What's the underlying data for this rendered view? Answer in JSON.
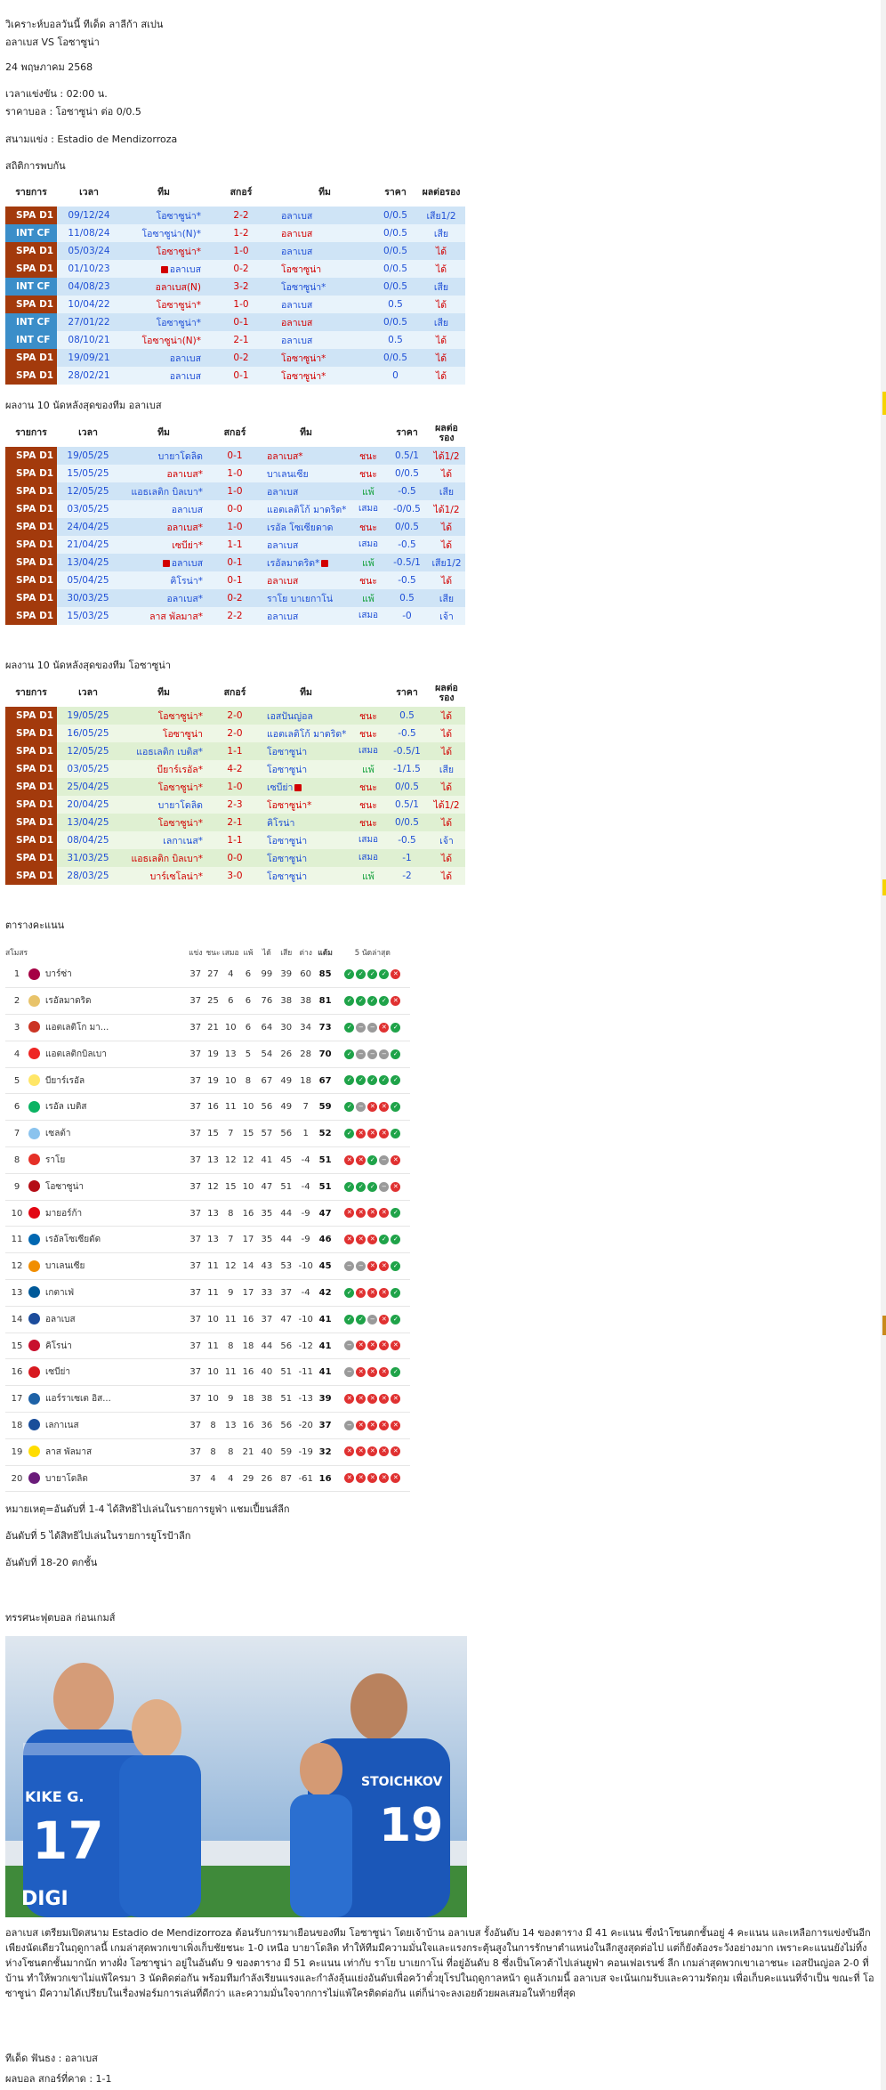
{
  "meta": {
    "title": "วิเคราะห์บอลวันนี้ ทีเด็ด ลาลีก้า สเปน",
    "match": "อลาเบส VS โอซาซูน่า",
    "date": "24 พฤษภาคม 2568",
    "kickoff": "เวลาแข่งขัน : 02:00  น.",
    "odds": "ราคาบอล : โอซาซูน่า ต่อ 0/0.5",
    "stadium": "สนามแข่ง : Estadio de Mendizorroza"
  },
  "h2h": {
    "label": "สถิติการพบกัน",
    "headers": [
      "รายการ",
      "เวลา",
      "ทีม",
      "สกอร์",
      "ทีม",
      "ราคา",
      "ผลต่อรอง"
    ],
    "rows": [
      {
        "league": "SPA D1",
        "kind": "spa",
        "date": "09/12/24",
        "home": "โอซาซูน่า*",
        "hc": "blue",
        "score": "2-2",
        "away": "อลาเบส",
        "ac": "blue",
        "hcp": "0/0.5",
        "res": "เสีย1/2",
        "rc": "b",
        "bg": "#cfe4f6"
      },
      {
        "league": "INT CF",
        "kind": "int",
        "date": "11/08/24",
        "home": "โอซาซูน่า(N)*",
        "hc": "blue",
        "score": "1-2",
        "away": "อลาเบส",
        "ac": "red",
        "hcp": "0/0.5",
        "res": "เสีย",
        "rc": "b",
        "bg": "#e8f3fb"
      },
      {
        "league": "SPA D1",
        "kind": "spa",
        "date": "05/03/24",
        "home": "โอซาซูน่า*",
        "hc": "red",
        "score": "1-0",
        "away": "อลาเบส",
        "ac": "blue",
        "hcp": "0/0.5",
        "res": "ได้",
        "rc": "r",
        "bg": "#cfe4f6"
      },
      {
        "league": "SPA D1",
        "kind": "spa",
        "date": "01/10/23",
        "home": "อลาเบส",
        "hc": "blue",
        "flag": true,
        "score": "0-2",
        "away": "โอซาซูน่า",
        "ac": "red",
        "hcp": "0/0.5",
        "res": "ได้",
        "rc": "r",
        "bg": "#e8f3fb"
      },
      {
        "league": "INT CF",
        "kind": "int",
        "date": "04/08/23",
        "home": "อลาเบส(N)",
        "hc": "red",
        "score": "3-2",
        "away": "โอซาซูน่า*",
        "ac": "blue",
        "hcp": "0/0.5",
        "res": "เสีย",
        "rc": "b",
        "bg": "#cfe4f6"
      },
      {
        "league": "SPA D1",
        "kind": "spa",
        "date": "10/04/22",
        "home": "โอซาซูน่า*",
        "hc": "red",
        "score": "1-0",
        "away": "อลาเบส",
        "ac": "blue",
        "hcp": "0.5",
        "res": "ได้",
        "rc": "r",
        "bg": "#e8f3fb"
      },
      {
        "league": "INT CF",
        "kind": "int",
        "date": "27/01/22",
        "home": "โอซาซูน่า*",
        "hc": "blue",
        "score": "0-1",
        "away": "อลาเบส",
        "ac": "red",
        "hcp": "0/0.5",
        "res": "เสีย",
        "rc": "b",
        "bg": "#cfe4f6"
      },
      {
        "league": "INT CF",
        "kind": "int",
        "date": "08/10/21",
        "home": "โอซาซูน่า(N)*",
        "hc": "red",
        "score": "2-1",
        "away": "อลาเบส",
        "ac": "blue",
        "hcp": "0.5",
        "res": "ได้",
        "rc": "r",
        "bg": "#e8f3fb"
      },
      {
        "league": "SPA D1",
        "kind": "spa",
        "date": "19/09/21",
        "home": "อลาเบส",
        "hc": "blue",
        "score": "0-2",
        "away": "โอซาซูน่า*",
        "ac": "red",
        "hcp": "0/0.5",
        "res": "ได้",
        "rc": "r",
        "bg": "#cfe4f6"
      },
      {
        "league": "SPA D1",
        "kind": "spa",
        "date": "28/02/21",
        "home": "อลาเบส",
        "hc": "blue",
        "score": "0-1",
        "away": "โอซาซูน่า*",
        "ac": "red",
        "hcp": "0",
        "res": "ได้",
        "rc": "r",
        "bg": "#e8f3fb"
      }
    ]
  },
  "formA": {
    "label": "ผลงาน 10 นัดหลังสุดของทีม อลาเบส",
    "headers": [
      "รายการ",
      "เวลา",
      "ทีม",
      "สกอร์",
      "ทีม",
      "",
      "ราคา",
      "ผลต่อรอง"
    ],
    "rows": [
      {
        "league": "SPA D1",
        "date": "19/05/25",
        "home": "บายาโดลิด",
        "hc": "blue",
        "score": "0-1",
        "away": "อลาเบส*",
        "ac": "red",
        "wdl": "ชนะ",
        "wc": "r",
        "hcp": "0.5/1",
        "res": "ได้1/2",
        "rc": "r",
        "bg": "#cfe4f6"
      },
      {
        "league": "SPA D1",
        "date": "15/05/25",
        "home": "อลาเบส*",
        "hc": "red",
        "score": "1-0",
        "away": "บาเลนเซีย",
        "ac": "blue",
        "wdl": "ชนะ",
        "wc": "r",
        "hcp": "0/0.5",
        "res": "ได้",
        "rc": "r",
        "bg": "#e8f3fb"
      },
      {
        "league": "SPA D1",
        "date": "12/05/25",
        "home": "แอธเลติก บิลเบา*",
        "hc": "blue",
        "score": "1-0",
        "away": "อลาเบส",
        "ac": "blue",
        "wdl": "แพ้",
        "wc": "g",
        "hcp": "-0.5",
        "res": "เสีย",
        "rc": "b",
        "bg": "#cfe4f6"
      },
      {
        "league": "SPA D1",
        "date": "03/05/25",
        "home": "อลาเบส",
        "hc": "blue",
        "score": "0-0",
        "away": "แอตเลติโก้ มาดริด*",
        "ac": "blue",
        "wdl": "เสมอ",
        "wc": "b",
        "hcp": "-0/0.5",
        "res": "ได้1/2",
        "rc": "r",
        "bg": "#e8f3fb"
      },
      {
        "league": "SPA D1",
        "date": "24/04/25",
        "home": "อลาเบส*",
        "hc": "red",
        "score": "1-0",
        "away": "เรอัล โซเซียดาด",
        "ac": "blue",
        "wdl": "ชนะ",
        "wc": "r",
        "hcp": "0/0.5",
        "res": "ได้",
        "rc": "r",
        "bg": "#cfe4f6"
      },
      {
        "league": "SPA D1",
        "date": "21/04/25",
        "home": "เซบีย่า*",
        "hc": "red",
        "score": "1-1",
        "away": "อลาเบส",
        "ac": "blue",
        "wdl": "เสมอ",
        "wc": "b",
        "hcp": "-0.5",
        "res": "ได้",
        "rc": "r",
        "bg": "#e8f3fb"
      },
      {
        "league": "SPA D1",
        "date": "13/04/25",
        "home": "อลาเบส",
        "hc": "blue",
        "flag": true,
        "score": "0-1",
        "away": "เรอัลมาดริด*",
        "ac": "blue",
        "aflag": true,
        "wdl": "แพ้",
        "wc": "g",
        "hcp": "-0.5/1",
        "res": "เสีย1/2",
        "rc": "b",
        "bg": "#cfe4f6"
      },
      {
        "league": "SPA D1",
        "date": "05/04/25",
        "home": "คิโรน่า*",
        "hc": "blue",
        "score": "0-1",
        "away": "อลาเบส",
        "ac": "red",
        "wdl": "ชนะ",
        "wc": "r",
        "hcp": "-0.5",
        "res": "ได้",
        "rc": "r",
        "bg": "#e8f3fb"
      },
      {
        "league": "SPA D1",
        "date": "30/03/25",
        "home": "อลาเบส*",
        "hc": "blue",
        "score": "0-2",
        "away": "ราโย บาเยกาโน่",
        "ac": "blue",
        "wdl": "แพ้",
        "wc": "g",
        "hcp": "0.5",
        "res": "เสีย",
        "rc": "b",
        "bg": "#cfe4f6"
      },
      {
        "league": "SPA D1",
        "date": "15/03/25",
        "home": "ลาส พัลมาส*",
        "hc": "red",
        "score": "2-2",
        "away": "อลาเบส",
        "ac": "blue",
        "wdl": "เสมอ",
        "wc": "b",
        "hcp": "-0",
        "res": "เจ้า",
        "rc": "b",
        "bg": "#e8f3fb"
      }
    ]
  },
  "formB": {
    "label": "ผลงาน 10 นัดหลังสุดของทีม โอซาซูน่า",
    "headers": [
      "รายการ",
      "เวลา",
      "ทีม",
      "สกอร์",
      "ทีม",
      "",
      "ราคา",
      "ผลต่อรอง"
    ],
    "rows": [
      {
        "league": "SPA D1",
        "date": "19/05/25",
        "home": "โอซาซูน่า*",
        "hc": "red",
        "score": "2-0",
        "away": "เอสปันญ่อล",
        "ac": "blue",
        "wdl": "ชนะ",
        "wc": "r",
        "hcp": "0.5",
        "res": "ได้",
        "rc": "r",
        "bg": "#dff0d2"
      },
      {
        "league": "SPA D1",
        "date": "16/05/25",
        "home": "โอซาซูน่า",
        "hc": "red",
        "score": "2-0",
        "away": "แอตเลติโก้ มาดริด*",
        "ac": "blue",
        "wdl": "ชนะ",
        "wc": "r",
        "hcp": "-0.5",
        "res": "ได้",
        "rc": "r",
        "bg": "#eef7e6"
      },
      {
        "league": "SPA D1",
        "date": "12/05/25",
        "home": "แอธเลติก เบติส*",
        "hc": "blue",
        "score": "1-1",
        "away": "โอซาซูน่า",
        "ac": "blue",
        "wdl": "เสมอ",
        "wc": "b",
        "hcp": "-0.5/1",
        "res": "ได้",
        "rc": "r",
        "bg": "#dff0d2"
      },
      {
        "league": "SPA D1",
        "date": "03/05/25",
        "home": "บียาร์เรอัล*",
        "hc": "red",
        "score": "4-2",
        "away": "โอซาซูน่า",
        "ac": "blue",
        "wdl": "แพ้",
        "wc": "g",
        "hcp": "-1/1.5",
        "res": "เสีย",
        "rc": "b",
        "bg": "#eef7e6"
      },
      {
        "league": "SPA D1",
        "date": "25/04/25",
        "home": "โอซาซูน่า*",
        "hc": "red",
        "score": "1-0",
        "away": "เซบีย่า",
        "ac": "blue",
        "aflag": true,
        "wdl": "ชนะ",
        "wc": "r",
        "hcp": "0/0.5",
        "res": "ได้",
        "rc": "r",
        "bg": "#dff0d2"
      },
      {
        "league": "SPA D1",
        "date": "20/04/25",
        "home": "บายาโดลิด",
        "hc": "blue",
        "score": "2-3",
        "away": "โอซาซูน่า*",
        "ac": "red",
        "wdl": "ชนะ",
        "wc": "r",
        "hcp": "0.5/1",
        "res": "ได้1/2",
        "rc": "r",
        "bg": "#eef7e6"
      },
      {
        "league": "SPA D1",
        "date": "13/04/25",
        "home": "โอซาซูน่า*",
        "hc": "red",
        "score": "2-1",
        "away": "คิโรน่า",
        "ac": "blue",
        "wdl": "ชนะ",
        "wc": "r",
        "hcp": "0/0.5",
        "res": "ได้",
        "rc": "r",
        "bg": "#dff0d2"
      },
      {
        "league": "SPA D1",
        "date": "08/04/25",
        "home": "เลกาเนส*",
        "hc": "blue",
        "score": "1-1",
        "away": "โอซาซูน่า",
        "ac": "blue",
        "wdl": "เสมอ",
        "wc": "b",
        "hcp": "-0.5",
        "res": "เจ้า",
        "rc": "b",
        "bg": "#eef7e6"
      },
      {
        "league": "SPA D1",
        "date": "31/03/25",
        "home": "แอธเลติก บิลเบา*",
        "hc": "red",
        "score": "0-0",
        "away": "โอซาซูน่า",
        "ac": "blue",
        "wdl": "เสมอ",
        "wc": "b",
        "hcp": "-1",
        "res": "ได้",
        "rc": "r",
        "bg": "#dff0d2"
      },
      {
        "league": "SPA D1",
        "date": "28/03/25",
        "home": "บาร์เซโลน่า*",
        "hc": "red",
        "score": "3-0",
        "away": "โอซาซูน่า",
        "ac": "blue",
        "wdl": "แพ้",
        "wc": "g",
        "hcp": "-2",
        "res": "ได้",
        "rc": "r",
        "bg": "#eef7e6"
      }
    ]
  },
  "standings": {
    "label": "ตารางคะแนน",
    "headers": [
      "สโมสร",
      "แข่ง",
      "ชนะ",
      "เสมอ",
      "แพ้",
      "ได้",
      "เสีย",
      "ต่าง",
      "แต้ม",
      "5 นัดล่าสุด"
    ],
    "rows": [
      {
        "pos": "1",
        "team": "บาร์ซ่า",
        "c": "#a50044",
        "p": "37",
        "w": "27",
        "d": "4",
        "l": "6",
        "gf": "99",
        "ga": "39",
        "gd": "60",
        "pts": "85",
        "form": "wwwwl"
      },
      {
        "pos": "2",
        "team": "เรอัลมาดริด",
        "c": "#e8c36a",
        "p": "37",
        "w": "25",
        "d": "6",
        "l": "6",
        "gf": "76",
        "ga": "38",
        "gd": "38",
        "pts": "81",
        "form": "wwwwl"
      },
      {
        "pos": "3",
        "team": "แอตเลติโก มา...",
        "c": "#cb3524",
        "p": "37",
        "w": "21",
        "d": "10",
        "l": "6",
        "gf": "64",
        "ga": "30",
        "gd": "34",
        "pts": "73",
        "form": "wddlw"
      },
      {
        "pos": "4",
        "team": "แอตเลติกบิลเบา",
        "c": "#ee2523",
        "p": "37",
        "w": "19",
        "d": "13",
        "l": "5",
        "gf": "54",
        "ga": "26",
        "gd": "28",
        "pts": "70",
        "form": "wdddw"
      },
      {
        "pos": "5",
        "team": "บียาร์เรอัล",
        "c": "#ffe667",
        "p": "37",
        "w": "19",
        "d": "10",
        "l": "8",
        "gf": "67",
        "ga": "49",
        "gd": "18",
        "pts": "67",
        "form": "wwwww"
      },
      {
        "pos": "6",
        "team": "เรอัล เบติส",
        "c": "#0bb363",
        "p": "37",
        "w": "16",
        "d": "11",
        "l": "10",
        "gf": "56",
        "ga": "49",
        "gd": "7",
        "pts": "59",
        "form": "wdllw"
      },
      {
        "pos": "7",
        "team": "เซลต้า",
        "c": "#8ac3ee",
        "p": "37",
        "w": "15",
        "d": "7",
        "l": "15",
        "gf": "57",
        "ga": "56",
        "gd": "1",
        "pts": "52",
        "form": "wlllw"
      },
      {
        "pos": "8",
        "team": "ราโย",
        "c": "#e53027",
        "p": "37",
        "w": "13",
        "d": "12",
        "l": "12",
        "gf": "41",
        "ga": "45",
        "gd": "-4",
        "pts": "51",
        "form": "llwdl"
      },
      {
        "pos": "9",
        "team": "โอซาซูน่า",
        "c": "#b40d16",
        "p": "37",
        "w": "12",
        "d": "15",
        "l": "10",
        "gf": "47",
        "ga": "51",
        "gd": "-4",
        "pts": "51",
        "form": "wwwdl"
      },
      {
        "pos": "10",
        "team": "มายอร์ก้า",
        "c": "#e20613",
        "p": "37",
        "w": "13",
        "d": "8",
        "l": "16",
        "gf": "35",
        "ga": "44",
        "gd": "-9",
        "pts": "47",
        "form": "llllw"
      },
      {
        "pos": "11",
        "team": "เรอัลโซเซียดัด",
        "c": "#0067b1",
        "p": "37",
        "w": "13",
        "d": "7",
        "l": "17",
        "gf": "35",
        "ga": "44",
        "gd": "-9",
        "pts": "46",
        "form": "lllww"
      },
      {
        "pos": "12",
        "team": "บาเลนเซีย",
        "c": "#f18e00",
        "p": "37",
        "w": "11",
        "d": "12",
        "l": "14",
        "gf": "43",
        "ga": "53",
        "gd": "-10",
        "pts": "45",
        "form": "ddllw"
      },
      {
        "pos": "13",
        "team": "เกตาเฟ่",
        "c": "#005999",
        "p": "37",
        "w": "11",
        "d": "9",
        "l": "17",
        "gf": "33",
        "ga": "37",
        "gd": "-4",
        "pts": "42",
        "form": "wlllw"
      },
      {
        "pos": "14",
        "team": "อลาเบส",
        "c": "#1c4c9c",
        "p": "37",
        "w": "10",
        "d": "11",
        "l": "16",
        "gf": "37",
        "ga": "47",
        "gd": "-10",
        "pts": "41",
        "form": "wwdlw"
      },
      {
        "pos": "15",
        "team": "คิโรน่า",
        "c": "#c8102e",
        "p": "37",
        "w": "11",
        "d": "8",
        "l": "18",
        "gf": "44",
        "ga": "56",
        "gd": "-12",
        "pts": "41",
        "form": "dllll"
      },
      {
        "pos": "16",
        "team": "เซบีย่า",
        "c": "#d71920",
        "p": "37",
        "w": "10",
        "d": "11",
        "l": "16",
        "gf": "40",
        "ga": "51",
        "gd": "-11",
        "pts": "41",
        "form": "dlllw"
      },
      {
        "pos": "17",
        "team": "แอร์ราเซเต อิส...",
        "c": "#1e62a7",
        "p": "37",
        "w": "10",
        "d": "9",
        "l": "18",
        "gf": "38",
        "ga": "51",
        "gd": "-13",
        "pts": "39",
        "form": "lllll"
      },
      {
        "pos": "18",
        "team": "เลกาเนส",
        "c": "#1a4e9a",
        "p": "37",
        "w": "8",
        "d": "13",
        "l": "16",
        "gf": "36",
        "ga": "56",
        "gd": "-20",
        "pts": "37",
        "form": "dllll"
      },
      {
        "pos": "19",
        "team": "ลาส พัลมาส",
        "c": "#ffdd00",
        "p": "37",
        "w": "8",
        "d": "8",
        "l": "21",
        "gf": "40",
        "ga": "59",
        "gd": "-19",
        "pts": "32",
        "form": "lllll"
      },
      {
        "pos": "20",
        "team": "บายาโดลิด",
        "c": "#6a1b7a",
        "p": "37",
        "w": "4",
        "d": "4",
        "l": "29",
        "gf": "26",
        "ga": "87",
        "gd": "-61",
        "pts": "16",
        "form": "lllll"
      }
    ]
  },
  "notes": {
    "n1": "หมายเหตุ=อันดับที่ 1-4 ได้สิทธิไปเล่นในรายการยูฟ่า แชมเปี้ยนส์ลีก",
    "n2": "อันดับที่ 5 ได้สิทธิไปเล่นในรายการยูโรป้าลีก",
    "n3": "อันดับที่ 18-20 ตกชั้น"
  },
  "analysis": {
    "label": "ทรรศนะฟุตบอล ก่อนเกมส์",
    "photo_text": [
      "KIKE G.",
      "17",
      "DIGI",
      "STOICHKOV",
      "19"
    ],
    "paragraph": "อลาเบส เตรียมเปิดสนาม Estadio de Mendizorroza ต้อนรับการมาเยือนของทีม โอซาซูน่า โดยเจ้าบ้าน อลาเบส รั้งอันดับ 14 ของตาราง มี 41 คะแนน ซึ่งนำโซนตกชั้นอยู่ 4 คะแนน และเหลือการแข่งขันอีกเพียงนัดเดียวในฤดูกาลนี้ เกมล่าสุดพวกเขาเพิ่งเก็บชัยชนะ 1-0 เหนือ บายาโดลิด ทำให้ทีมมีความมั่นใจและแรงกระตุ้นสูงในการรักษาตำแหน่งในลีกสูงสุดต่อไป แต่ก็ยังต้องระวังอย่างมาก เพราะคะแนนยังไม่ทิ้งห่างโซนตกชั้นมากนัก ทางฝั่ง โอซาซูน่า อยู่ในอันดับ 9 ของตาราง มี 51 คะแนน เท่ากับ ราโย บาเยกาโน่ ที่อยู่อันดับ 8 ซึ่งเป็นโควต้าไปเล่นยูฟ่า คอนเฟอเรนซ์ ลีก เกมล่าสุดพวกเขาเอาชนะ เอสปันญ่อล 2-0 ที่บ้าน ทำให้พวกเขาไม่แพ้ใครมา 3 นัดติดต่อกัน พร้อมทีมกำลังเรียนแรงและกำลังลุ้นแย่งอันดับเพื่อคว้าตั๋วยุโรปในฤดูกาลหน้า ดูแล้วเกมนี้ อลาเบส จะเน้นเกมรับและความรัดกุม เพื่อเก็บคะแนนที่จำเป็น ขณะที่ โอซาซูน่า มีความได้เปรียบในเรื่องฟอร์มการเล่นที่ดีกว่า และความมั่นใจจากการไม่แพ้ใครติดต่อกัน แต่ก็น่าจะลงเอยด้วยผลเสมอในท้ายที่สุด"
  },
  "pick": {
    "tip": "ทีเด็ด ฟันธง : อลาเบส",
    "score": "ผลบอล สกอร์ที่คาด  : 1-1"
  }
}
